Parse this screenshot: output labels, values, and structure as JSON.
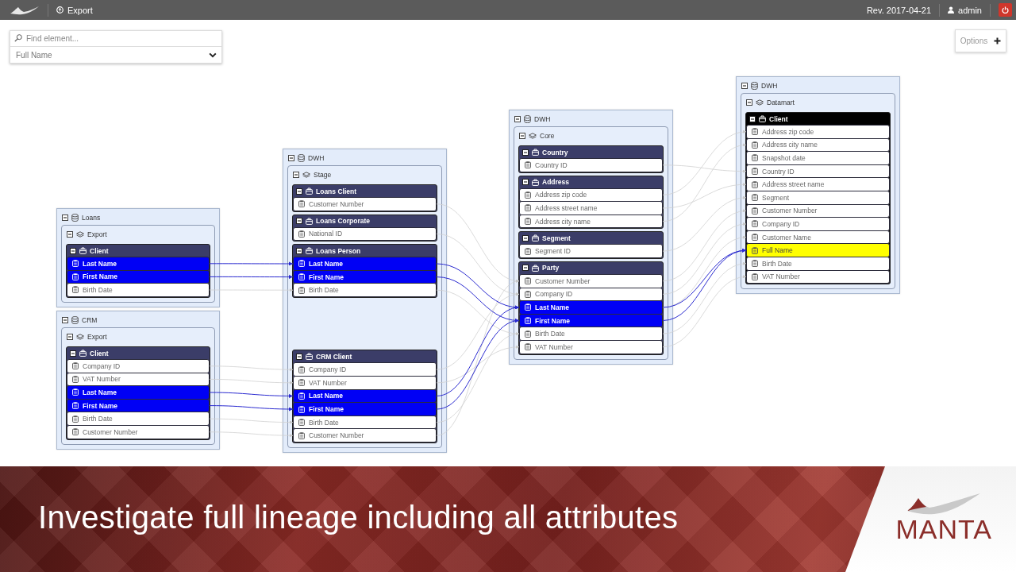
{
  "top_bar": {
    "menu": "Export",
    "revision": "Rev. 2017-04-21",
    "user": "admin"
  },
  "search": {
    "placeholder": "Find element...",
    "filter": "Full Name"
  },
  "options_button": "Options",
  "databases": [
    {
      "name": "Loans",
      "schema": {
        "name": "Export",
        "tables": [
          {
            "name": "Client",
            "selected": false,
            "columns": [
              {
                "name": "Last Name",
                "highlighted": true,
                "selected": false
              },
              {
                "name": "First Name",
                "highlighted": true,
                "selected": false
              },
              {
                "name": "Birth Date",
                "highlighted": false,
                "selected": false
              }
            ]
          }
        ]
      }
    },
    {
      "name": "CRM",
      "schema": {
        "name": "Export",
        "tables": [
          {
            "name": "Client",
            "selected": false,
            "columns": [
              {
                "name": "Company ID",
                "highlighted": false,
                "selected": false
              },
              {
                "name": "VAT Number",
                "highlighted": false,
                "selected": false
              },
              {
                "name": "Last Name",
                "highlighted": true,
                "selected": false
              },
              {
                "name": "First Name",
                "highlighted": true,
                "selected": false
              },
              {
                "name": "Birth Date",
                "highlighted": false,
                "selected": false
              },
              {
                "name": "Customer Number",
                "highlighted": false,
                "selected": false
              }
            ]
          }
        ]
      }
    },
    {
      "name": "DWH",
      "schema": {
        "name": "Stage",
        "tables": [
          {
            "name": "Loans Client",
            "selected": false,
            "columns": [
              {
                "name": "Customer Number",
                "highlighted": false,
                "selected": false
              }
            ]
          },
          {
            "name": "Loans Corporate",
            "selected": false,
            "columns": [
              {
                "name": "National ID",
                "highlighted": false,
                "selected": false
              }
            ]
          },
          {
            "name": "Loans Person",
            "selected": false,
            "columns": [
              {
                "name": "Last Name",
                "highlighted": true,
                "selected": false
              },
              {
                "name": "First Name",
                "highlighted": true,
                "selected": false
              },
              {
                "name": "Birth Date",
                "highlighted": false,
                "selected": false
              }
            ]
          },
          {
            "name": "CRM Client",
            "selected": false,
            "columns": [
              {
                "name": "Company ID",
                "highlighted": false,
                "selected": false
              },
              {
                "name": "VAT Number",
                "highlighted": false,
                "selected": false
              },
              {
                "name": "Last Name",
                "highlighted": true,
                "selected": false
              },
              {
                "name": "First Name",
                "highlighted": true,
                "selected": false
              },
              {
                "name": "Birth Date",
                "highlighted": false,
                "selected": false
              },
              {
                "name": "Customer Number",
                "highlighted": false,
                "selected": false
              }
            ]
          }
        ]
      }
    },
    {
      "name": "DWH",
      "schema": {
        "name": "Core",
        "tables": [
          {
            "name": "Country",
            "selected": false,
            "columns": [
              {
                "name": "Country ID",
                "highlighted": false,
                "selected": false
              }
            ]
          },
          {
            "name": "Address",
            "selected": false,
            "columns": [
              {
                "name": "Address zip code",
                "highlighted": false,
                "selected": false
              },
              {
                "name": "Address street name",
                "highlighted": false,
                "selected": false
              },
              {
                "name": "Address city name",
                "highlighted": false,
                "selected": false
              }
            ]
          },
          {
            "name": "Segment",
            "selected": false,
            "columns": [
              {
                "name": "Segment ID",
                "highlighted": false,
                "selected": false
              }
            ]
          },
          {
            "name": "Party",
            "selected": false,
            "columns": [
              {
                "name": "Customer Number",
                "highlighted": false,
                "selected": false
              },
              {
                "name": "Company ID",
                "highlighted": false,
                "selected": false
              },
              {
                "name": "Last Name",
                "highlighted": true,
                "selected": false
              },
              {
                "name": "First Name",
                "highlighted": true,
                "selected": false
              },
              {
                "name": "Birth Date",
                "highlighted": false,
                "selected": false
              },
              {
                "name": "VAT Number",
                "highlighted": false,
                "selected": false
              }
            ]
          }
        ]
      }
    },
    {
      "name": "DWH",
      "schema": {
        "name": "Datamart",
        "tables": [
          {
            "name": "Client",
            "selected": true,
            "columns": [
              {
                "name": "Address zip code",
                "highlighted": false,
                "selected": false
              },
              {
                "name": "Address city name",
                "highlighted": false,
                "selected": false
              },
              {
                "name": "Snapshot date",
                "highlighted": false,
                "selected": false
              },
              {
                "name": "Country ID",
                "highlighted": false,
                "selected": false
              },
              {
                "name": "Address street name",
                "highlighted": false,
                "selected": false
              },
              {
                "name": "Segment",
                "highlighted": false,
                "selected": false
              },
              {
                "name": "Customer Number",
                "highlighted": false,
                "selected": false
              },
              {
                "name": "Company ID",
                "highlighted": false,
                "selected": false
              },
              {
                "name": "Customer Name",
                "highlighted": false,
                "selected": false
              },
              {
                "name": "Full Name",
                "highlighted": false,
                "selected": true
              },
              {
                "name": "Birth Date",
                "highlighted": false,
                "selected": false
              },
              {
                "name": "VAT Number",
                "highlighted": false,
                "selected": false
              }
            ]
          }
        ]
      }
    }
  ],
  "banner": {
    "caption": "Investigate full lineage including all attributes",
    "brand": "MANTA"
  }
}
